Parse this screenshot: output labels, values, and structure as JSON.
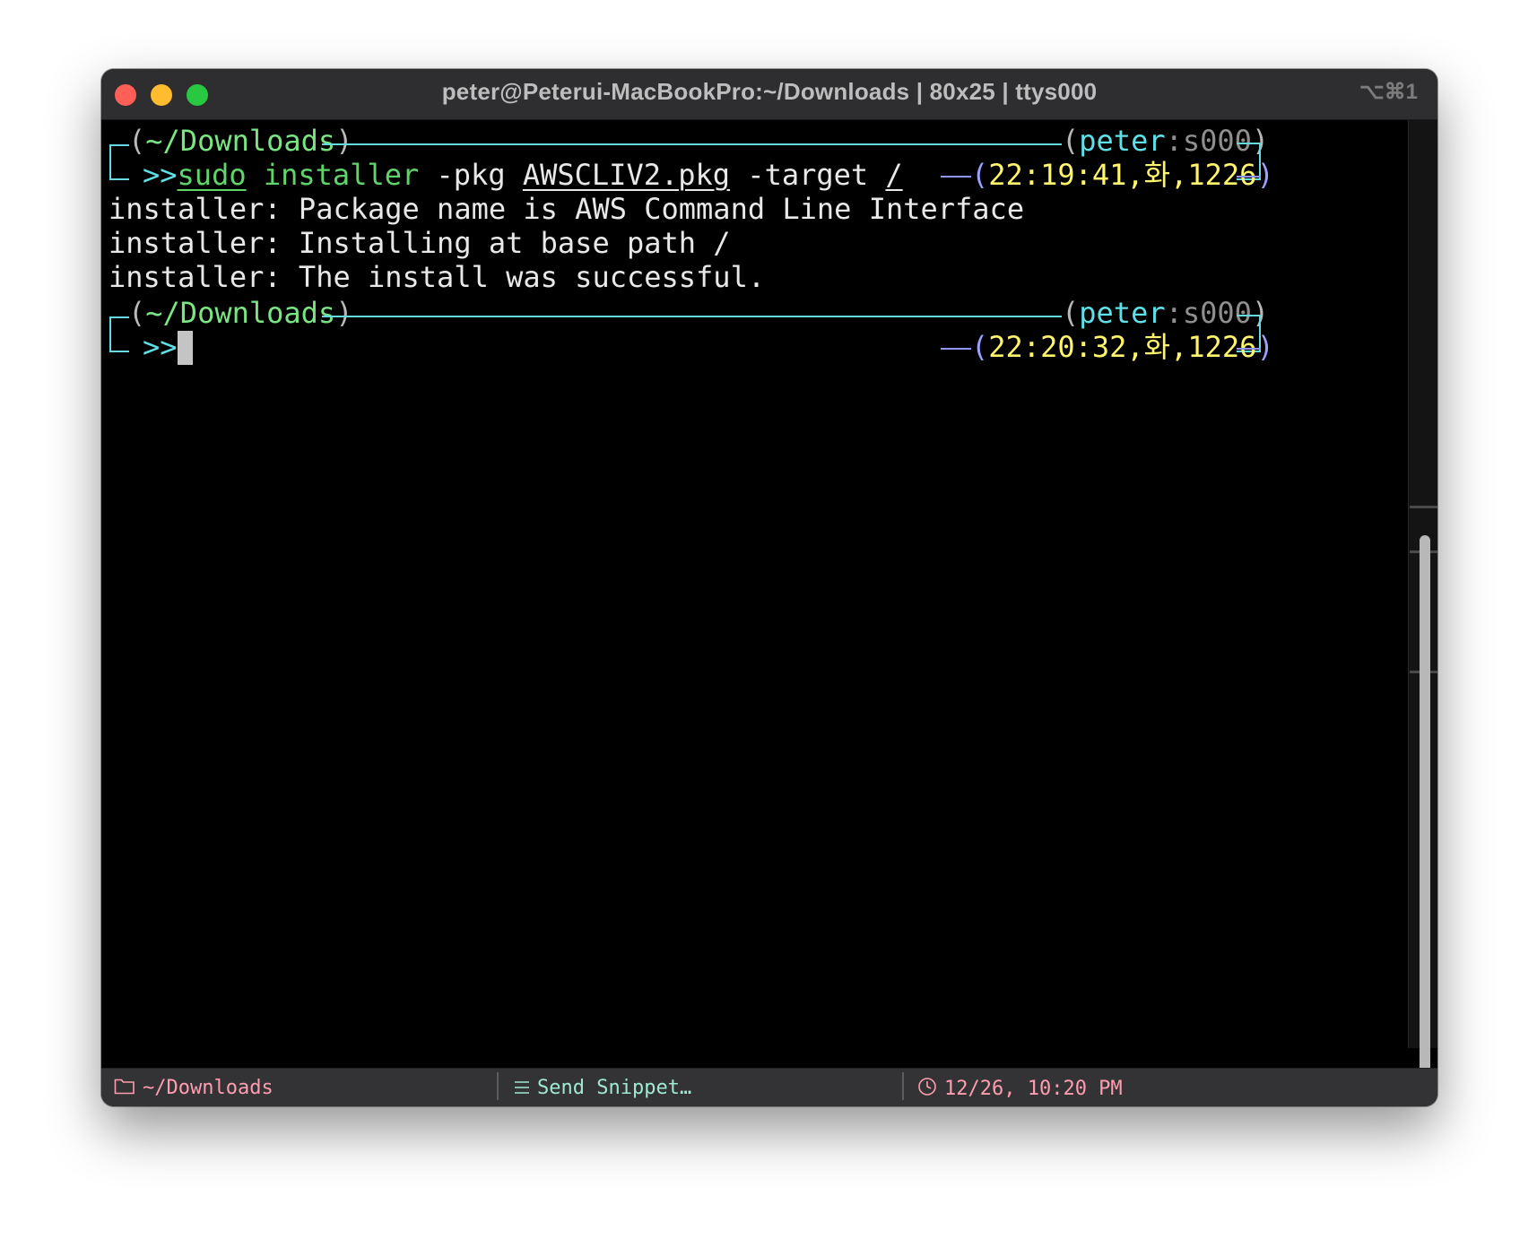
{
  "titlebar": {
    "title": "peter@Peterui-MacBookPro:~/Downloads | 80x25 | ttys000",
    "shortcut": "⌥⌘1"
  },
  "prompts": [
    {
      "dir": "~/Downloads",
      "user": "peter",
      "sep": ":",
      "tty": "s000",
      "arrow": ">>",
      "time": "22:19:41,화,1226",
      "command": {
        "sudo": "sudo",
        "installer": "installer",
        "flag_pkg": "-pkg",
        "pkg": "AWSCLIV2.pkg",
        "flag_target": "-target",
        "target": "/"
      }
    },
    {
      "dir": "~/Downloads",
      "user": "peter",
      "sep": ":",
      "tty": "s000",
      "arrow": ">>",
      "time": "22:20:32,화,1226"
    }
  ],
  "output": [
    "installer: Package name is AWS Command Line Interface",
    "installer: Installing at base path /",
    "installer: The install was successful."
  ],
  "statusbar": {
    "directory": "~/Downloads",
    "snippet": "Send Snippet…",
    "clock": "12/26, 10:20 PM"
  },
  "icons": {
    "folder": "folder-icon",
    "snippet": "menu-lines-icon",
    "clock": "clock-icon"
  }
}
